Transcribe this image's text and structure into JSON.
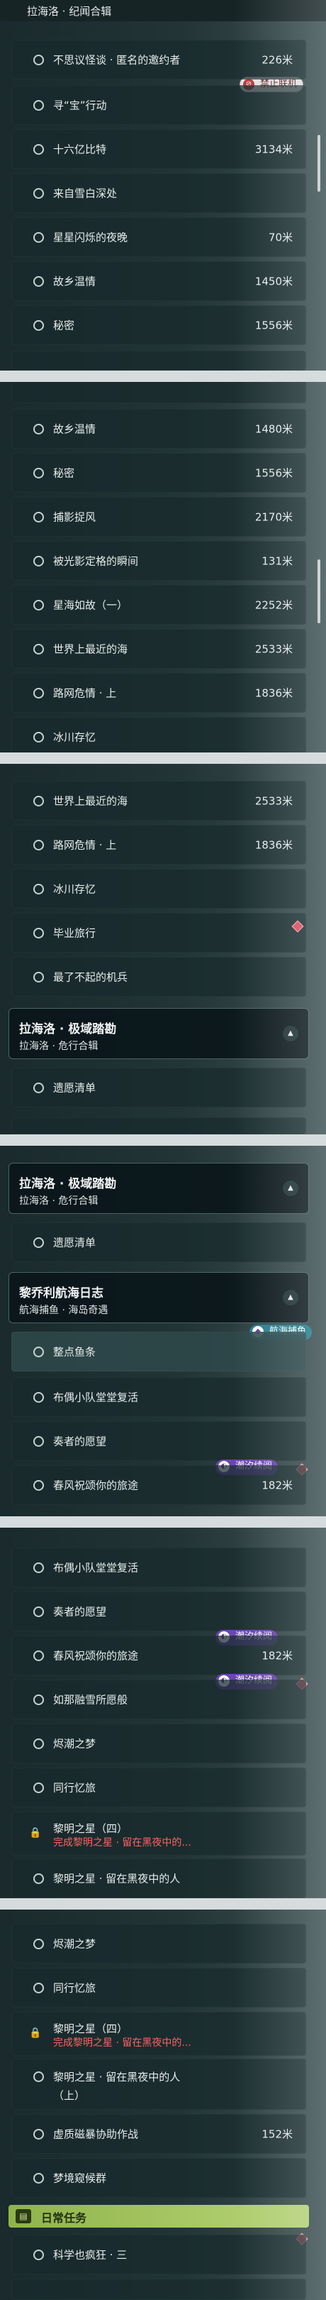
{
  "panel1": {
    "header_sub": "拉海洛 · 纪闻合辑",
    "badge_ban": "禁止联机",
    "rows": [
      {
        "name": "不思议怪谈 · 匿名的邀约者",
        "dist": "226米"
      },
      {
        "name": "寻“宝”行动",
        "dist": ""
      },
      {
        "name": "十六亿比特",
        "dist": "3134米"
      },
      {
        "name": "来自雪白深处",
        "dist": ""
      },
      {
        "name": "星星闪烁的夜晚",
        "dist": "70米"
      },
      {
        "name": "故乡温情",
        "dist": "1450米"
      },
      {
        "name": "秘密",
        "dist": "1556米"
      }
    ]
  },
  "panel2": {
    "rows": [
      {
        "name": "故乡温情",
        "dist": "1480米"
      },
      {
        "name": "秘密",
        "dist": "1556米"
      },
      {
        "name": "捕影捉风",
        "dist": "2170米"
      },
      {
        "name": "被光影定格的瞬间",
        "dist": "131米"
      },
      {
        "name": "星海如故（一）",
        "dist": "2252米"
      },
      {
        "name": "世界上最近的海",
        "dist": "2533米"
      },
      {
        "name": "路网危情 · 上",
        "dist": "1836米"
      },
      {
        "name": "冰川存忆",
        "dist": ""
      }
    ]
  },
  "panel3": {
    "rows": [
      {
        "name": "世界上最近的海",
        "dist": "2533米"
      },
      {
        "name": "路网危情 · 上",
        "dist": "1836米"
      },
      {
        "name": "冰川存忆",
        "dist": ""
      },
      {
        "name": "毕业旅行",
        "dist": ""
      },
      {
        "name": "最了不起的机兵",
        "dist": ""
      }
    ],
    "header": {
      "title": "拉海洛 · 极域踏勘",
      "sub": "拉海洛 · 危行合辑"
    },
    "after": {
      "name": "遗愿清单",
      "dist": ""
    }
  },
  "panel4": {
    "header1": {
      "title": "拉海洛 · 极域踏勘",
      "sub": "拉海洛 · 危行合辑"
    },
    "row1": {
      "name": "遗愿清单"
    },
    "header2": {
      "title": "黎乔利航海日志",
      "sub": "航海捕鱼 · 海岛奇遇"
    },
    "badge_sea": "航海捕鱼",
    "row2": {
      "name": "整点鱼条"
    },
    "rows": [
      {
        "name": "布偶小队堂堂复活",
        "dist": ""
      },
      {
        "name": "奏者的愿望",
        "dist": ""
      },
      {
        "name": "春风祝颂你的旅途",
        "dist": "182米"
      }
    ],
    "badge_tide": "潮汐续阅"
  },
  "panel5": {
    "rows": [
      {
        "name": "布偶小队堂堂复活",
        "dist": ""
      },
      {
        "name": "奏者的愿望",
        "dist": ""
      },
      {
        "name": "春风祝颂你的旅途",
        "dist": "182米"
      },
      {
        "name": "如那融雪所愿般",
        "dist": ""
      },
      {
        "name": "烬潮之梦",
        "dist": ""
      },
      {
        "name": "同行忆旅",
        "dist": ""
      }
    ],
    "badge_tide": "潮汐续阅",
    "badge_tide2": "潮汐续阅",
    "locked1": {
      "name": "黎明之星（四）",
      "sub": "完成黎明之星 · 留在黑夜中的..."
    },
    "locked2": {
      "name": "黎明之星 · 留在黑夜中的人",
      "sub": ""
    }
  },
  "panel6": {
    "rows": [
      {
        "name": "烬潮之梦",
        "dist": ""
      },
      {
        "name": "同行忆旅",
        "dist": ""
      }
    ],
    "locked": {
      "name": "黎明之星（四）",
      "sub": "完成黎明之星 · 留在黑夜中的..."
    },
    "tall": {
      "line1": "黎明之星 · 留在黑夜中的人",
      "line2": "（上）"
    },
    "rows2": [
      {
        "name": "虚质磁暴协助作战",
        "dist": "152米"
      },
      {
        "name": "梦境窥候群",
        "dist": ""
      }
    ],
    "daily_label": "日常任务",
    "last": {
      "name": "科学也疯狂 · 三",
      "dist": ""
    }
  }
}
